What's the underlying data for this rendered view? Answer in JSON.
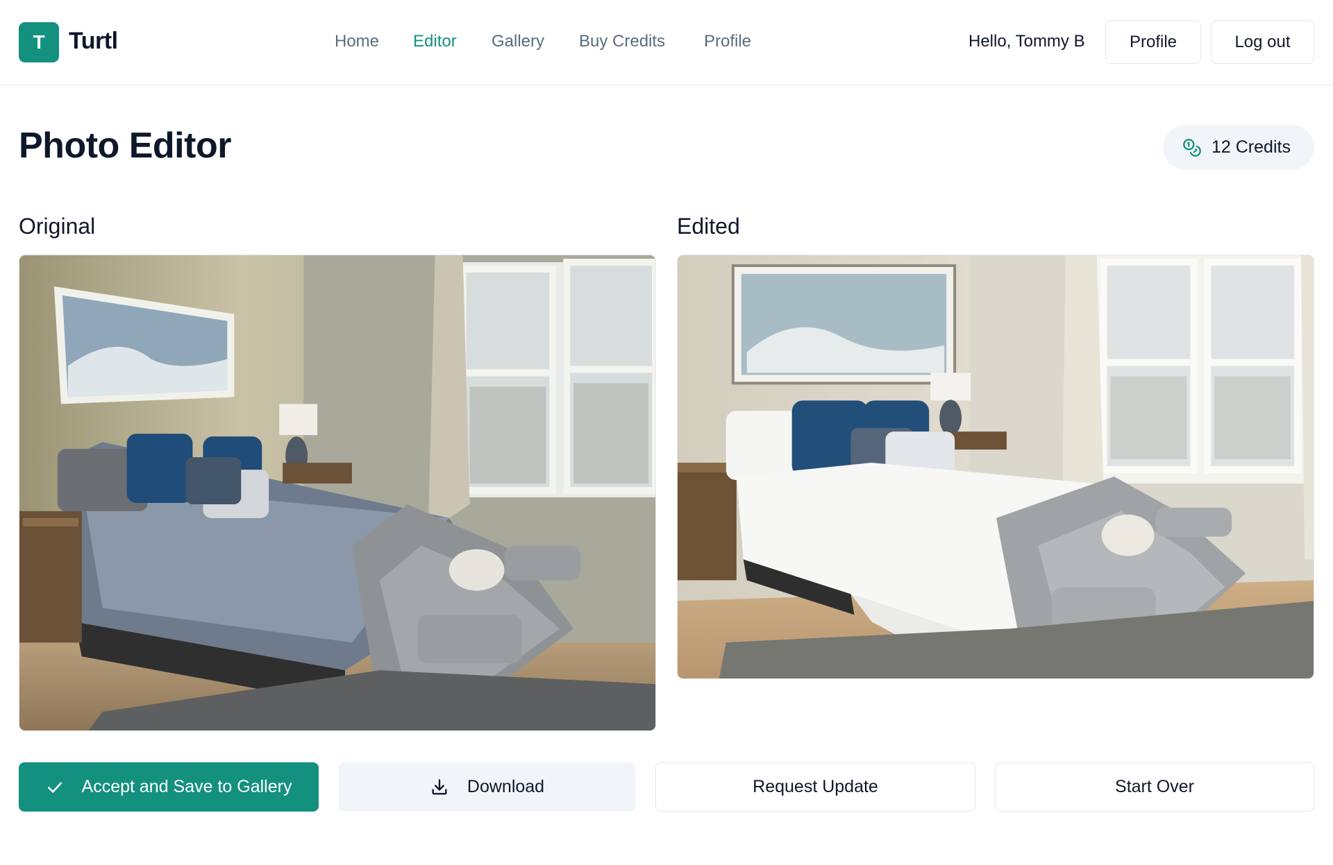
{
  "brand": {
    "logo_letter": "T",
    "name": "Turtl"
  },
  "nav": [
    {
      "label": "Home",
      "active": false
    },
    {
      "label": "Editor",
      "active": true
    },
    {
      "label": "Gallery",
      "active": false
    },
    {
      "label": "Buy Credits",
      "active": false
    },
    {
      "label": "Profile",
      "active": false
    }
  ],
  "user": {
    "greeting": "Hello, Tommy B",
    "profile_label": "Profile",
    "logout_label": "Log out"
  },
  "page": {
    "title": "Photo Editor",
    "credits_label": "12 Credits",
    "credits_icon": "coins-icon"
  },
  "columns": {
    "original_label": "Original",
    "edited_label": "Edited"
  },
  "actions": {
    "accept_label": "Accept and Save to Gallery",
    "accept_icon": "check-icon",
    "download_label": "Download",
    "download_icon": "download-icon",
    "request_update_label": "Request Update",
    "start_over_label": "Start Over"
  },
  "colors": {
    "accent": "#14907f",
    "nav_text": "#5b6b7d",
    "muted_bg": "#f1f5f9",
    "border": "#e2e8f0"
  }
}
